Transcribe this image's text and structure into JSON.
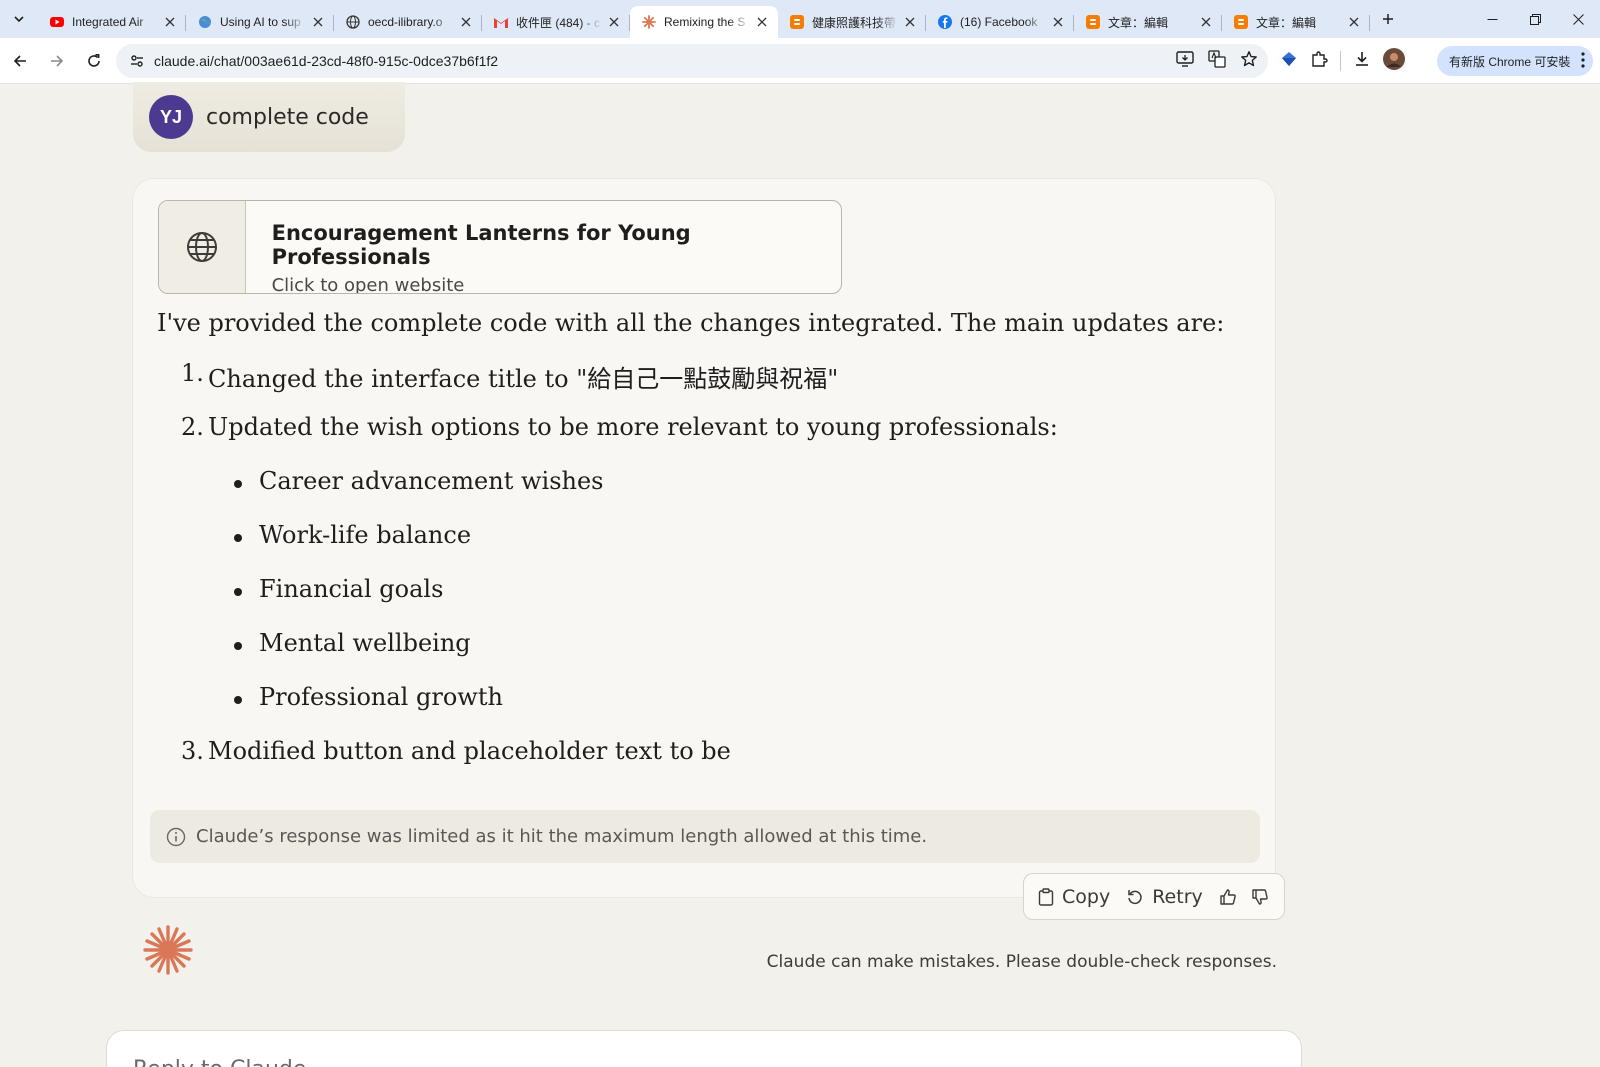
{
  "browser": {
    "tabs": [
      {
        "title": "Integrated Air",
        "icon": "youtube-icon",
        "active": false
      },
      {
        "title": "Using AI to sup",
        "icon": "earth-icon",
        "active": false
      },
      {
        "title": "oecd-ilibrary.o",
        "icon": "globe-icon",
        "active": false
      },
      {
        "title": "收件匣 (484) - c",
        "icon": "gmail-icon",
        "active": false
      },
      {
        "title": "Remixing the S",
        "icon": "claude-icon",
        "active": true
      },
      {
        "title": "健康照護科技帶",
        "icon": "blogger-icon",
        "active": false
      },
      {
        "title": "(16) Facebook",
        "icon": "facebook-icon",
        "active": false
      },
      {
        "title": "文章：編輯",
        "icon": "blogger-icon",
        "active": false
      },
      {
        "title": "文章：編輯",
        "icon": "blogger-icon",
        "active": false
      }
    ],
    "url": "claude.ai/chat/003ae61d-23cd-48f0-915c-0dce37b6f1f2",
    "update_label": "有新版 Chrome 可安裝"
  },
  "chat": {
    "user_initials": "YJ",
    "user_message": "complete code",
    "artifact": {
      "title": "Encouragement Lanterns for Young Professionals",
      "subtitle": "Click to open website"
    },
    "response": {
      "intro": "I've provided the complete code with all the changes integrated. The main updates are:",
      "items": [
        {
          "num": "1.",
          "text": "Changed the interface title to \"給自己一點鼓勵與祝福\""
        },
        {
          "num": "2.",
          "text": "Updated the wish options to be more relevant to young professionals:"
        },
        {
          "num": "3.",
          "text": "Modified button and placeholder text to be"
        }
      ],
      "bullets": [
        "Career advancement wishes",
        "Work-life balance",
        "Financial goals",
        "Mental wellbeing",
        "Professional growth"
      ]
    },
    "limit_notice": "Claude’s response was limited as it hit the maximum length allowed at this time.",
    "actions": {
      "copy": "Copy",
      "retry": "Retry"
    },
    "disclaimer": "Claude can make mistakes. Please double-check responses.",
    "reply_placeholder": "Reply to Claude..."
  },
  "colors": {
    "accent": "#d97757",
    "avatar": "#4b3a8f",
    "background": "#f3f1eb"
  }
}
